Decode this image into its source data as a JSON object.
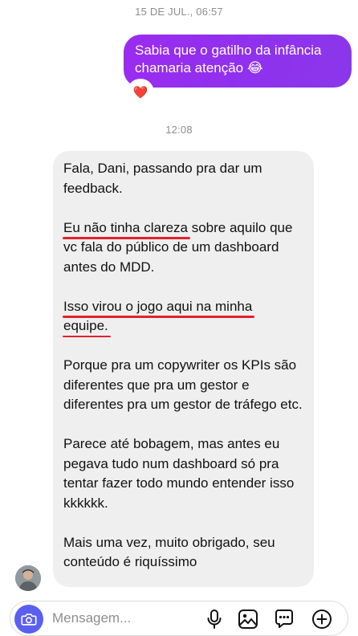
{
  "thread": {
    "timestamp_1": "15 DE JUL., 06:57",
    "sent_message": "Sabia que o gatilho da infância chamaria atenção 😂",
    "reaction": "❤️",
    "timestamp_2": "12:08",
    "received": {
      "p1": "Fala, Dani, passando pra dar um feedback.",
      "p2_highlight": "Eu não tinha clareza",
      "p2_rest": " sobre aquilo que vc fala do público de um dashboard antes do MDD.",
      "p3_highlight_1": "Isso virou o jogo aqui na minha",
      "p3_highlight_2": "equipe.",
      "p4": "Porque pra um copywriter os KPIs são diferentes que pra um gestor e diferentes pra um gestor de tráfego etc.",
      "p5": "Parece até bobagem, mas antes eu pegava tudo num dashboard só pra tentar fazer todo mundo entender isso kkkkkk.",
      "p6": "Mais uma vez, muito obrigado, seu conteúdo é riquíssimo"
    }
  },
  "composer": {
    "placeholder": "Mensagem...",
    "icons": [
      "camera-icon",
      "microphone-icon",
      "image-icon",
      "sticker-icon",
      "add-icon"
    ]
  },
  "colors": {
    "sent_bubble": "#9b2bf0",
    "received_bubble": "#efeff0",
    "camera_button": "#5a5ff3",
    "underline": "#e3212c"
  }
}
